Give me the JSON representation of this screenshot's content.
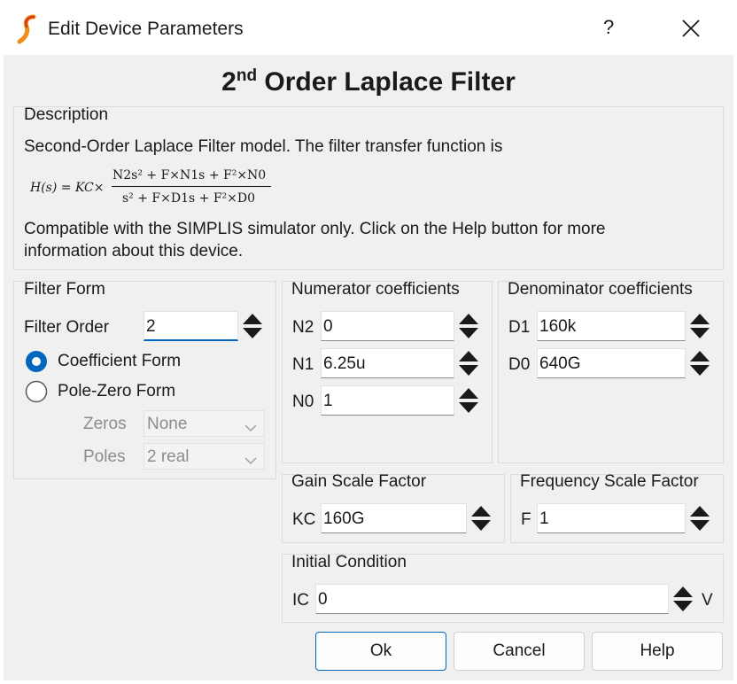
{
  "window": {
    "title": "Edit Device Parameters",
    "help_label": "?",
    "close_label": "✕",
    "app_icon": "simplis-logo-icon"
  },
  "heading": {
    "main": "2",
    "sup": "nd",
    "rest": " Order Laplace Filter"
  },
  "description": {
    "group_label": "Description",
    "line1": "Second-Order Laplace Filter model. The filter transfer function is",
    "eq_lhs": "H(s) = KC×",
    "eq_num": "N2s² + F×N1s + F²×N0",
    "eq_den": "s² + F×D1s + F²×D0",
    "line2": "Compatible with the SIMPLIS simulator only. Click on the Help button for more",
    "line3": "information about this device."
  },
  "filter_form": {
    "group_label": "Filter Form",
    "order_label": "Filter Order",
    "order_value": "2",
    "coefficient_label": "Coefficient Form",
    "polezero_label": "Pole-Zero Form",
    "selected": "coefficient",
    "zeros_label": "Zeros",
    "zeros_value": "None",
    "poles_label": "Poles",
    "poles_value": "2 real"
  },
  "numerator": {
    "group_label": "Numerator coefficients",
    "n2_label": "N2",
    "n2_value": "0",
    "n1_label": "N1",
    "n1_value": "6.25u",
    "n0_label": "N0",
    "n0_value": "1"
  },
  "denominator": {
    "group_label": "Denominator coefficients",
    "d1_label": "D1",
    "d1_value": "160k",
    "d0_label": "D0",
    "d0_value": "640G"
  },
  "gain": {
    "group_label": "Gain Scale Factor",
    "kc_label": "KC",
    "kc_value": "160G"
  },
  "frequency": {
    "group_label": "Frequency Scale Factor",
    "f_label": "F",
    "f_value": "1"
  },
  "initial": {
    "group_label": "Initial Condition",
    "ic_label": "IC",
    "ic_value": "0",
    "unit": "V"
  },
  "buttons": {
    "ok": "Ok",
    "cancel": "Cancel",
    "help": "Help"
  },
  "colors": {
    "accent": "#0067c0",
    "dialog_bg": "#f0f0f0",
    "logo": "#f08c1a"
  }
}
